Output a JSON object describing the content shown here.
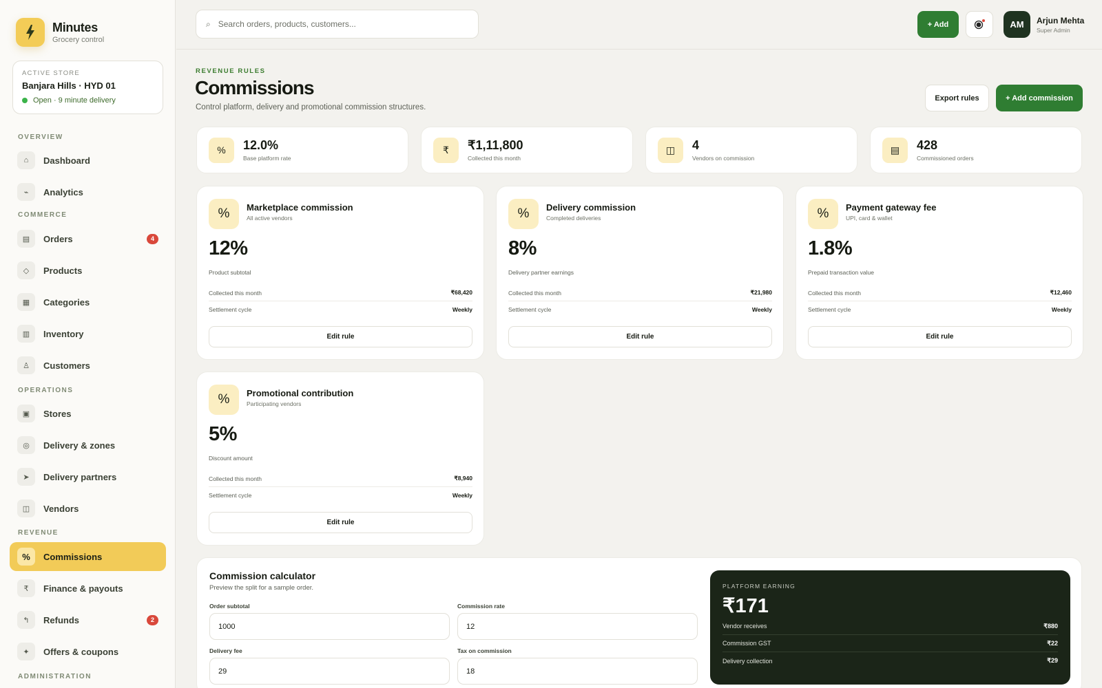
{
  "brand": {
    "name": "Minutes",
    "subtitle": "Grocery control",
    "logo_icon": "lightning-icon"
  },
  "store": {
    "kicker": "ACTIVE STORE",
    "name": "Banjara Hills · HYD 01",
    "status": "Open · 9 minute delivery"
  },
  "sidebar": {
    "sections": {
      "overview": "OVERVIEW",
      "commerce": "COMMERCE",
      "operations": "OPERATIONS",
      "revenue": "REVENUE",
      "administration": "ADMINISTRATION"
    },
    "items": [
      {
        "label": "Dashboard",
        "icon": "⌂",
        "icon_name": "home-icon"
      },
      {
        "label": "Analytics",
        "icon": "⌁",
        "icon_name": "analytics-icon"
      },
      {
        "label": "Orders",
        "icon": "▤",
        "icon_name": "orders-icon",
        "badge": "4"
      },
      {
        "label": "Products",
        "icon": "◇",
        "icon_name": "product-icon"
      },
      {
        "label": "Categories",
        "icon": "▦",
        "icon_name": "categories-icon"
      },
      {
        "label": "Inventory",
        "icon": "▥",
        "icon_name": "inventory-icon"
      },
      {
        "label": "Customers",
        "icon": "♙",
        "icon_name": "customers-icon"
      },
      {
        "label": "Stores",
        "icon": "▣",
        "icon_name": "store-icon"
      },
      {
        "label": "Delivery & zones",
        "icon": "◎",
        "icon_name": "zones-icon"
      },
      {
        "label": "Delivery partners",
        "icon": "➤",
        "icon_name": "delivery-partner-icon"
      },
      {
        "label": "Vendors",
        "icon": "◫",
        "icon_name": "vendors-icon"
      },
      {
        "label": "Commissions",
        "icon": "%",
        "icon_name": "percent-icon",
        "active": true
      },
      {
        "label": "Finance & payouts",
        "icon": "₹",
        "icon_name": "rupee-icon"
      },
      {
        "label": "Refunds",
        "icon": "↰",
        "icon_name": "refund-icon",
        "badge": "2"
      },
      {
        "label": "Offers & coupons",
        "icon": "✦",
        "icon_name": "offers-icon"
      }
    ]
  },
  "search": {
    "placeholder": "Search orders, products, customers..."
  },
  "topbar": {
    "add_label": "+ Add",
    "user_initials": "AM",
    "user_name": "Arjun Mehta",
    "user_role": "Super Admin"
  },
  "header": {
    "kicker": "REVENUE RULES",
    "title": "Commissions",
    "subtitle": "Control platform, delivery and promotional commission structures.",
    "export_label": "Export rules",
    "add_label": "+ Add commission"
  },
  "stats": [
    {
      "icon": "%",
      "icon_name": "percent-icon",
      "value": "12.0%",
      "label": "Base platform rate"
    },
    {
      "icon": "₹",
      "icon_name": "rupee-icon",
      "value": "₹1,11,800",
      "label": "Collected this month"
    },
    {
      "icon": "◫",
      "icon_name": "vendors-icon",
      "value": "4",
      "label": "Vendors on commission"
    },
    {
      "icon": "▤",
      "icon_name": "orders-icon",
      "value": "428",
      "label": "Commissioned orders"
    }
  ],
  "commissions": [
    {
      "title": "Marketplace commission",
      "subtitle": "All active vendors",
      "rate": "12%",
      "basis": "Product subtotal",
      "collected_label": "Collected this month",
      "collected": "₹68,420",
      "cycle_label": "Settlement cycle",
      "cycle": "Weekly",
      "button": "Edit rule"
    },
    {
      "title": "Delivery commission",
      "subtitle": "Completed deliveries",
      "rate": "8%",
      "basis": "Delivery partner earnings",
      "collected_label": "Collected this month",
      "collected": "₹21,980",
      "cycle_label": "Settlement cycle",
      "cycle": "Weekly",
      "button": "Edit rule"
    },
    {
      "title": "Payment gateway fee",
      "subtitle": "UPI, card & wallet",
      "rate": "1.8%",
      "basis": "Prepaid transaction value",
      "collected_label": "Collected this month",
      "collected": "₹12,460",
      "cycle_label": "Settlement cycle",
      "cycle": "Weekly",
      "button": "Edit rule"
    },
    {
      "title": "Promotional contribution",
      "subtitle": "Participating vendors",
      "rate": "5%",
      "basis": "Discount amount",
      "collected_label": "Collected this month",
      "collected": "₹8,940",
      "cycle_label": "Settlement cycle",
      "cycle": "Weekly",
      "button": "Edit rule"
    }
  ],
  "calculator": {
    "title": "Commission calculator",
    "subtitle": "Preview the split for a sample order.",
    "fields": {
      "order_subtotal": {
        "label": "Order subtotal",
        "value": "1000"
      },
      "commission_rate": {
        "label": "Commission rate",
        "value": "12"
      },
      "delivery_fee": {
        "label": "Delivery fee",
        "value": "29"
      },
      "tax": {
        "label": "Tax on commission",
        "value": "18"
      }
    },
    "earning": {
      "kicker": "PLATFORM EARNING",
      "value": "₹171",
      "rows": [
        {
          "label": "Vendor receives",
          "value": "₹880"
        },
        {
          "label": "Commission GST",
          "value": "₹22"
        },
        {
          "label": "Delivery collection",
          "value": "₹29"
        }
      ]
    }
  },
  "colors": {
    "accent": "#2f7d32",
    "highlight": "#f2cb58",
    "dark": "#1b2518",
    "badge": "#d9483b"
  }
}
